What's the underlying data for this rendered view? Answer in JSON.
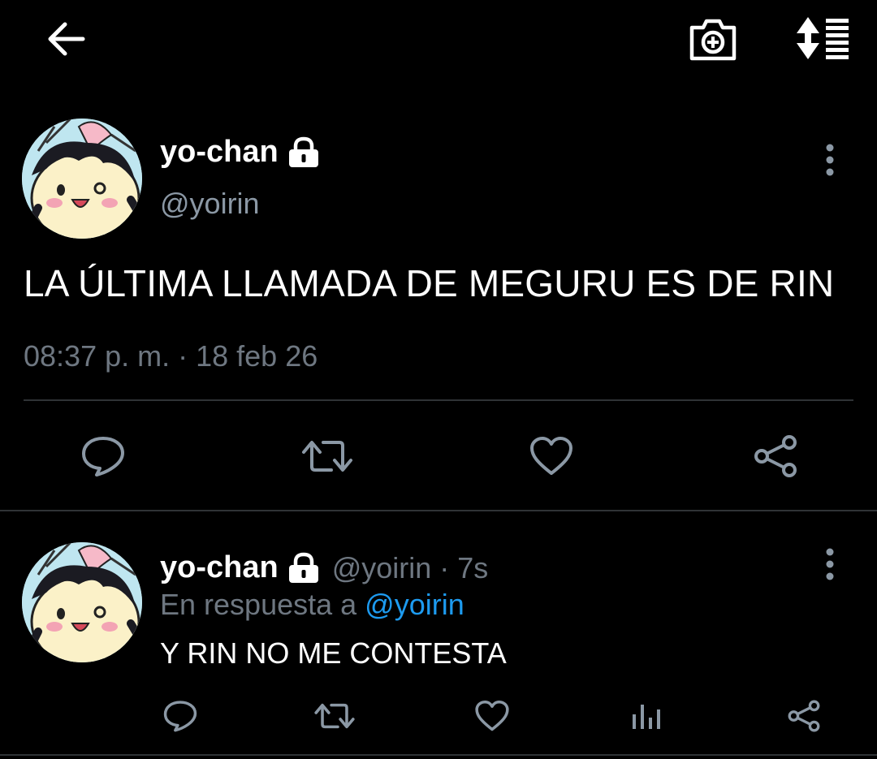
{
  "topbar": {
    "back_icon": "arrow-left-icon",
    "camera_icon": "camera-plus-icon",
    "sort_icon": "sort-list-icon"
  },
  "tweet": {
    "display_name": "yo-chan",
    "handle": "@yoirin",
    "text": "LA ÚLTIMA LLAMADA DE MEGURU ES DE RIN",
    "timestamp": "08:37 p. m. · 18 feb 26",
    "locked": true
  },
  "reply": {
    "display_name": "yo-chan",
    "handle_time": "@yoirin · 7s",
    "in_reply_prefix": "En respuesta a ",
    "in_reply_mention": "@yoirin",
    "text": "Y RIN NO ME CONTESTA",
    "locked": true
  },
  "colors": {
    "background": "#000000",
    "text": "#ffffff",
    "muted": "#6e7781",
    "link": "#1d9bf0",
    "divider": "#2f3336"
  }
}
